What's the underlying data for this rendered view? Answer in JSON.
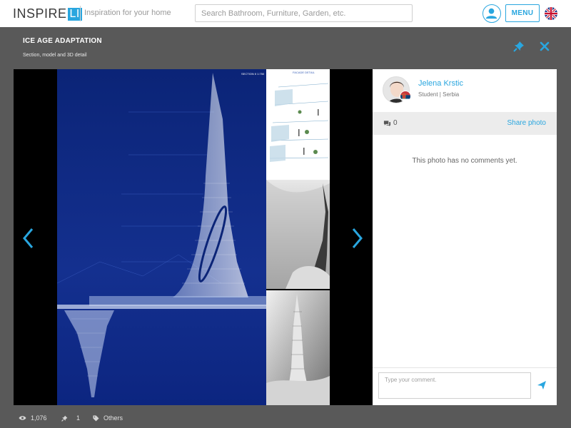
{
  "header": {
    "logo_text": "INSPIRE",
    "logo_box": "LI",
    "tagline": "Inspiration for your home",
    "search_placeholder": "Search Bathroom, Furniture, Garden, etc.",
    "menu_label": "MENU",
    "language_flag": "uk-flag-icon"
  },
  "photo": {
    "title": "ICE AGE ADAPTATION",
    "subtitle": "Section, model and 3D detail",
    "section_label": "SECTION II 1:750",
    "facade_label": "FACADE DETAIL"
  },
  "author": {
    "name": "Jelena Krstic",
    "info": "Student | Serbia",
    "country_flag": "serbia-flag-icon"
  },
  "comments": {
    "count": "0",
    "share_label": "Share photo",
    "empty_text": "This photo has no comments yet.",
    "input_placeholder": "Type your comment."
  },
  "footer": {
    "views": "1,076",
    "pins": "1",
    "category": "Others"
  },
  "colors": {
    "accent": "#29a6df",
    "overlay": "#595959",
    "blueprint": "#0e2a8a"
  }
}
